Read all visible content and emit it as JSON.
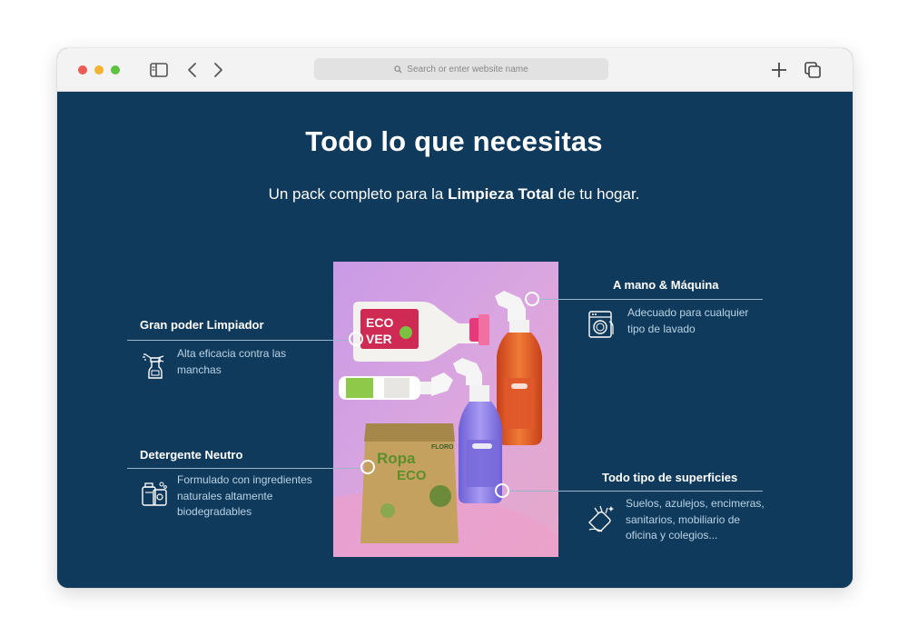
{
  "browser": {
    "address_placeholder": "Search or enter website name"
  },
  "page": {
    "title": "Todo lo que necesitas",
    "subtitle_prefix": "Un pack completo para la ",
    "subtitle_bold": "Limpieza Total",
    "subtitle_suffix": " de tu hogar."
  },
  "features": {
    "gran_poder": {
      "title": "Gran poder Limpiador",
      "desc_lines": [
        "Alta eficacia contra las",
        "manchas"
      ],
      "icon": "spray-bottle-icon"
    },
    "detergente": {
      "title": "Detergente Neutro",
      "desc_lines": [
        "Formulado con ingredientes",
        "naturales altamente",
        "biodegradables"
      ],
      "icon": "detergent-icon"
    },
    "mano_maquina": {
      "title": "A mano & Máquina",
      "desc_lines": [
        "Adecuado para cualquier",
        "tipo de lavado"
      ],
      "icon": "washing-machine-icon"
    },
    "superficies": {
      "title": "Todo tipo de superficies",
      "desc_lines": [
        "Suelos, azulejos, encimeras,",
        "sanitarios, mobiliario de",
        "oficina y colegios..."
      ],
      "icon": "cleaning-hand-icon"
    }
  },
  "product_labels": {
    "ecover_1": "ECO",
    "ecover_2": "VER",
    "pouch_1": "Ropa",
    "pouch_2": "ECO",
    "pouch_brand": "FLORO"
  },
  "colors": {
    "background": "#0f3a5c",
    "accent_text": "#b9d3e6",
    "photo_bg": "#d6a6e6"
  }
}
